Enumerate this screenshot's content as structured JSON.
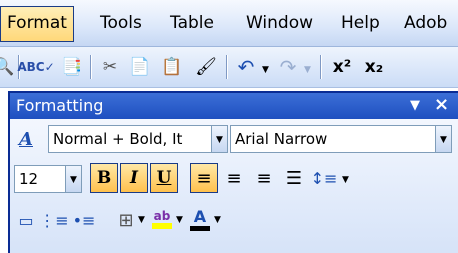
{
  "menubar": {
    "items": [
      {
        "label": "Format",
        "active": true
      },
      {
        "label": "Tools"
      },
      {
        "label": "Table"
      },
      {
        "label": "Window"
      },
      {
        "label": "Help"
      },
      {
        "label": "Adob"
      }
    ]
  },
  "standard_toolbar": {
    "icons": [
      "research-icon",
      "spelling-icon",
      "print-preview-icon",
      "cut-icon",
      "copy-icon",
      "paste-icon",
      "format-painter-icon",
      "undo-icon",
      "redo-icon",
      "superscript-icon",
      "subscript-icon"
    ]
  },
  "formatting": {
    "title": "Formatting",
    "style_value": "Normal + Bold, It",
    "font_value": "Arial Narrow",
    "size_value": "12",
    "bold_label": "B",
    "italic_label": "I",
    "underline_label": "U"
  },
  "colors": {
    "active_button": "#ffc14d",
    "title_bar": "#1e4fc0",
    "highlight": "#ffff00",
    "font_color": "#000000"
  }
}
